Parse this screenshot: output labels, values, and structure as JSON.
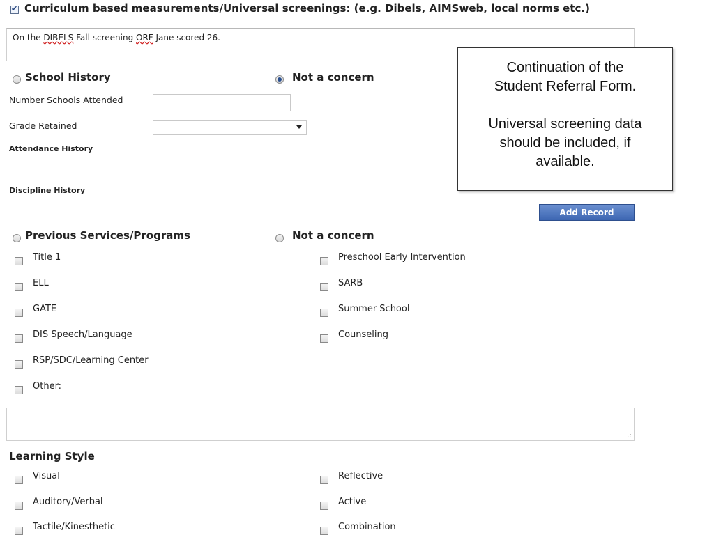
{
  "curriculum": {
    "heading": "Curriculum based measurements/Universal screenings: (e.g. Dibels, AIMSweb, local norms etc.)",
    "checked": true,
    "text_pre": "On the ",
    "text_w1": "DIBELS",
    "text_mid": " Fall screening ",
    "text_w2": "ORF",
    "text_post": " Jane scored 26."
  },
  "callout": {
    "line1": "Continuation of the",
    "line2": "Student Referral Form.",
    "line3": "Universal screening data",
    "line4": "should be included, if",
    "line5": "available."
  },
  "school_history": {
    "heading": "School History",
    "not_concern": "Not a concern",
    "not_concern_selected": true,
    "schools_label": "Number Schools Attended",
    "schools_value": "",
    "grade_label": "Grade Retained",
    "grade_value": "",
    "attendance_label": "Attendance History",
    "discipline_label": "Discipline History",
    "add_record": "Add Record"
  },
  "previous": {
    "heading": "Previous Services/Programs",
    "not_concern": "Not a concern",
    "left": [
      "Title 1",
      "ELL",
      "GATE",
      "DIS Speech/Language",
      "RSP/SDC/Learning Center",
      "Other:"
    ],
    "right": [
      "Preschool Early Intervention",
      "SARB",
      "Summer School",
      "Counseling"
    ],
    "other_value": ""
  },
  "learning": {
    "heading": "Learning Style",
    "left": [
      "Visual",
      "Auditory/Verbal",
      "Tactile/Kinesthetic"
    ],
    "right": [
      "Reflective",
      "Active",
      "Combination"
    ]
  },
  "colors": {
    "accent": "#3d66b2",
    "radio_selected": "#2a4f8e",
    "spellcheck": "#d02020"
  }
}
